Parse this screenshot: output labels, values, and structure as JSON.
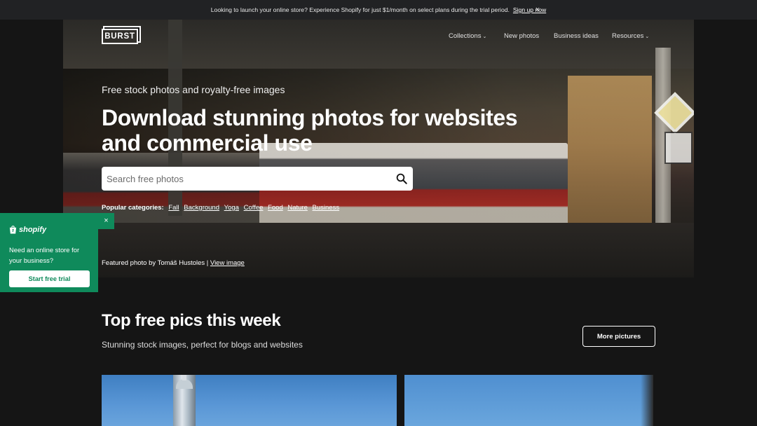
{
  "announcement": {
    "text": "Looking to launch your online store? Experience Shopify for just $1/month on select plans during the trial period.",
    "link": "Sign up now",
    "close": "×"
  },
  "header": {
    "logo": "BURST",
    "nav": [
      {
        "label": "Collections",
        "has_dropdown": true
      },
      {
        "label": "New photos",
        "has_dropdown": false
      },
      {
        "label": "Business ideas",
        "has_dropdown": false
      },
      {
        "label": "Resources",
        "has_dropdown": true
      }
    ]
  },
  "hero": {
    "subtitle": "Free stock photos and royalty-free images",
    "headline": "Download stunning photos for websites and commercial use",
    "search_placeholder": "Search free photos",
    "popular_label": "Popular categories:",
    "categories": [
      "Fall",
      "Background",
      "Yoga",
      "Coffee",
      "Food",
      "Nature",
      "Business"
    ],
    "credit_text": "Featured photo by Tomáš Hustoles |",
    "credit_link": "View image"
  },
  "promo": {
    "brand": "shopify",
    "text": "Need an online store for your business?",
    "button": "Start free trial",
    "close": "×",
    "accent": "#0f8a5b"
  },
  "section": {
    "title": "Top free pics this week",
    "subtitle": "Stunning stock images, perfect for blogs and websites",
    "more_button": "More pictures"
  },
  "colors": {
    "background": "#151515",
    "announcement_bg": "#212224",
    "shopify_green": "#0f8a5b"
  }
}
